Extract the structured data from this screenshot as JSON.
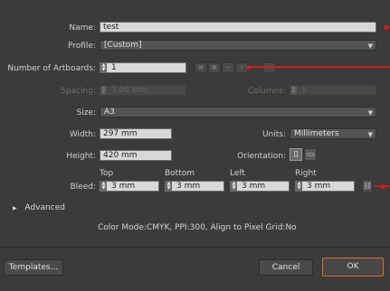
{
  "name": {
    "label": "Name:",
    "value": "test"
  },
  "profile": {
    "label": "Profile:",
    "value": "[Custom]"
  },
  "artboards": {
    "label": "Number of Artboards:",
    "value": "1"
  },
  "spacing": {
    "label": "Spacing:",
    "value": "7.06 mm"
  },
  "columns": {
    "label": "Columns:",
    "value": "1"
  },
  "size": {
    "label": "Size:",
    "value": "A3"
  },
  "width": {
    "label": "Width:",
    "value": "297 mm"
  },
  "units": {
    "label": "Units:",
    "value": "Millimeters"
  },
  "height": {
    "label": "Height:",
    "value": "420 mm"
  },
  "orientation": {
    "label": "Orientation:"
  },
  "bleed": {
    "label": "Bleed:",
    "headers": {
      "top": "Top",
      "bottom": "Bottom",
      "left": "Left",
      "right": "Right"
    },
    "top": "3 mm",
    "bottom": "3 mm",
    "left": "3 mm",
    "right": "3 mm"
  },
  "advanced": {
    "label": "Advanced"
  },
  "summary": "Color Mode:CMYK, PPI:300, Align to Pixel Grid:No",
  "buttons": {
    "templates": "Templates...",
    "cancel": "Cancel",
    "ok": "OK"
  },
  "colors": {
    "background": "#3b3b3b",
    "annotation": "#d11d1d",
    "focus": "#e06a2a"
  }
}
